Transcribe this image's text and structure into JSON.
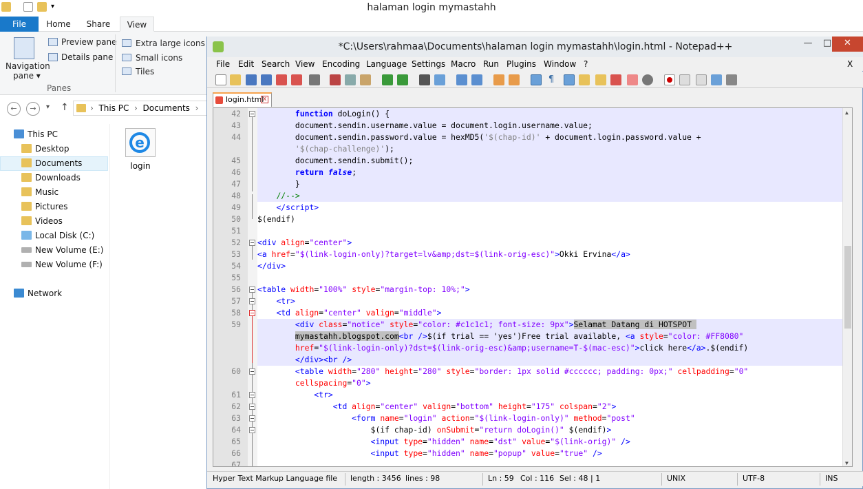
{
  "explorer": {
    "title": "halaman login mymastahh",
    "tabs": [
      "File",
      "Home",
      "Share",
      "View"
    ],
    "ribbon": {
      "nav_pane": "Navigation",
      "nav_pane2": "pane",
      "preview_pane": "Preview pane",
      "details_pane": "Details pane",
      "panes_group": "Panes",
      "extra_large_icons": "Extra large icons",
      "small_icons": "Small icons",
      "tiles": "Tiles"
    },
    "breadcrumb": [
      "This PC",
      "Documents"
    ],
    "tree": [
      {
        "label": "This PC",
        "color": "#4a8fd6"
      },
      {
        "label": "Desktop",
        "color": "#e8c25a"
      },
      {
        "label": "Documents",
        "color": "#e8c25a"
      },
      {
        "label": "Downloads",
        "color": "#e8c25a"
      },
      {
        "label": "Music",
        "color": "#e8c25a"
      },
      {
        "label": "Pictures",
        "color": "#e8c25a"
      },
      {
        "label": "Videos",
        "color": "#e8c25a"
      },
      {
        "label": "Local Disk (C:)",
        "color": "#7ab7e8"
      },
      {
        "label": "New Volume (E:)",
        "color": "#b0b0b0"
      },
      {
        "label": "New Volume (F:)",
        "color": "#b0b0b0"
      },
      {
        "label": "Network",
        "color": "#3b8ad2"
      }
    ],
    "file": {
      "name": "login",
      "icon": "ie-html-icon"
    }
  },
  "npp": {
    "title": "*C:\\Users\\rahmaa\\Documents\\halaman login mymastahh\\login.html - Notepad++",
    "menu": [
      "File",
      "Edit",
      "Search",
      "View",
      "Encoding",
      "Language",
      "Settings",
      "Macro",
      "Run",
      "Plugins",
      "Window",
      "?"
    ],
    "menu_close": "X",
    "tab": "login.html",
    "status": {
      "type": "Hyper Text Markup Language file",
      "length": "length : 3456",
      "lines": "lines : 98",
      "ln": "Ln : 59",
      "col": "Col : 116",
      "sel": "Sel : 48 | 1",
      "eol": "UNIX",
      "enc": "UTF-8",
      "ins": "INS"
    },
    "line_numbers": [
      "42",
      "43",
      "44",
      "",
      "45",
      "46",
      "47",
      "48",
      "49",
      "50",
      "51",
      "52",
      "53",
      "54",
      "55",
      "56",
      "57",
      "58",
      "59",
      "",
      "",
      "",
      "60",
      "",
      "61",
      "62",
      "63",
      "64",
      "65",
      "66",
      "67"
    ]
  },
  "code_colors": {
    "tag": "#0000ff",
    "attr": "#ff0000",
    "string": "#8000ff",
    "comment": "#008000",
    "highlight": "#e8e8ff"
  }
}
